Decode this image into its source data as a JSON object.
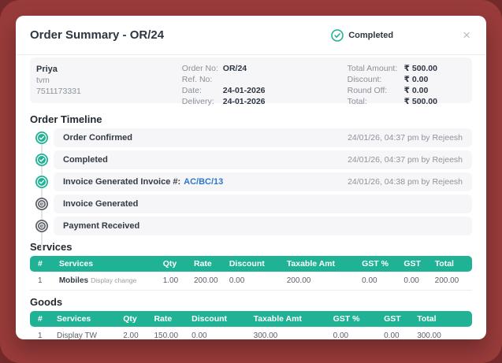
{
  "modal": {
    "title": "Order Summary - OR/24",
    "status": {
      "label": "Completed"
    },
    "close_label": "×"
  },
  "customer": {
    "name": "Priya",
    "location": "tvm",
    "phone": "7511173331"
  },
  "order": {
    "fields": [
      {
        "label": "Order No:",
        "value": "OR/24"
      },
      {
        "label": "Ref. No:",
        "value": ""
      },
      {
        "label": "Date:",
        "value": "24-01-2026"
      },
      {
        "label": "Delivery:",
        "value": "24-01-2026"
      }
    ],
    "totals": [
      {
        "label": "Total Amount:",
        "value": "₹ 500.00"
      },
      {
        "label": "Discount:",
        "value": "₹ 0.00"
      },
      {
        "label": "Round Off:",
        "value": "₹ 0.00"
      },
      {
        "label": "Total:",
        "value": "₹ 500.00"
      }
    ]
  },
  "timeline": {
    "heading": "Order Timeline",
    "events": [
      {
        "label": "Order Confirmed",
        "link": "",
        "timestamp": "24/01/26, 04:37 pm by Rejeesh",
        "state": "done",
        "icon": "check-circle-icon"
      },
      {
        "label": "Completed",
        "link": "",
        "timestamp": "24/01/26, 04:37 pm by Rejeesh",
        "state": "done",
        "icon": "check-circle-icon"
      },
      {
        "label": "Invoice Generated Invoice #:",
        "link": "AC/BC/13",
        "timestamp": "24/01/26, 04:38 pm by Rejeesh",
        "state": "done",
        "icon": "check-circle-icon"
      },
      {
        "label": "Invoice Generated",
        "link": "",
        "timestamp": "",
        "state": "pending",
        "icon": "clock-icon"
      },
      {
        "label": "Payment Received",
        "link": "",
        "timestamp": "",
        "state": "pending",
        "icon": "clock-icon"
      }
    ]
  },
  "services": {
    "heading": "Services",
    "columns": [
      "#",
      "Services",
      "Qty",
      "Rate",
      "Discount",
      "Taxable Amt",
      "GST %",
      "GST",
      "Total"
    ],
    "rows": [
      {
        "num": "1",
        "name": "Mobiles",
        "desc": "Display change",
        "qty": "1.00",
        "rate": "200.00",
        "discount": "0.00",
        "taxable": "200.00",
        "gst_pct": "0.00",
        "gst": "0.00",
        "total": "200.00"
      }
    ]
  },
  "goods": {
    "heading": "Goods",
    "columns": [
      "#",
      "Services",
      "Qty",
      "Rate",
      "Discount",
      "Taxable Amt",
      "GST %",
      "GST",
      "Total"
    ],
    "rows": [
      {
        "num": "1",
        "name": "Display TW",
        "desc": "",
        "qty": "2.00",
        "rate": "150.00",
        "discount": "0.00",
        "taxable": "300.00",
        "gst_pct": "0.00",
        "gst": "0.00",
        "total": "300.00"
      }
    ]
  },
  "colors": {
    "accent_teal": "#1fb295",
    "link_blue": "#2e77c8",
    "pending_gray": "#5d6269",
    "background_maroon": "#9a3b3b"
  }
}
